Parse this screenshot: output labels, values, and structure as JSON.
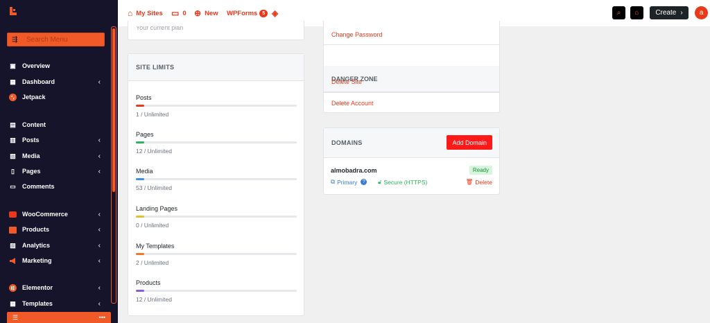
{
  "sidebar": {
    "search_placeholder": "Search Menu",
    "items": [
      {
        "label": "Overview",
        "icon": "grid-icon",
        "chevron": false
      },
      {
        "label": "Dashboard",
        "icon": "dashboard-icon",
        "chevron": true
      },
      {
        "label": "Jetpack",
        "icon": "jetpack-icon",
        "chevron": false
      },
      {
        "label": "Content",
        "icon": "content-icon",
        "chevron": false
      },
      {
        "label": "Posts",
        "icon": "posts-icon",
        "chevron": true
      },
      {
        "label": "Media",
        "icon": "media-icon",
        "chevron": true
      },
      {
        "label": "Pages",
        "icon": "pages-icon",
        "chevron": true
      },
      {
        "label": "Comments",
        "icon": "comments-icon",
        "chevron": false
      },
      {
        "label": "WooCommerce",
        "icon": "woocommerce-icon",
        "chevron": true
      },
      {
        "label": "Products",
        "icon": "products-icon",
        "chevron": true
      },
      {
        "label": "Analytics",
        "icon": "analytics-icon",
        "chevron": true
      },
      {
        "label": "Marketing",
        "icon": "marketing-icon",
        "chevron": true
      },
      {
        "label": "Elementor",
        "icon": "elementor-icon",
        "chevron": true
      },
      {
        "label": "Templates",
        "icon": "templates-icon",
        "chevron": true
      }
    ],
    "bottom_more": "•••"
  },
  "topbar": {
    "my_sites": "My Sites",
    "comments_count": "0",
    "new_label": "New",
    "wpforms_label": "WPForms",
    "wpforms_badge": "5",
    "create_label": "Create",
    "create_chevron": "›",
    "avatar_letter": "a"
  },
  "account_stub": {
    "text": "Your current plan"
  },
  "site_limits": {
    "title": "SITE LIMITS",
    "items": [
      {
        "name": "Posts",
        "value": "1 / Unlimited",
        "color": "#e8391b"
      },
      {
        "name": "Pages",
        "value": "12 / Unlimited",
        "color": "#2bb55a"
      },
      {
        "name": "Media",
        "value": "53 / Unlimited",
        "color": "#3a8ee6"
      },
      {
        "name": "Landing Pages",
        "value": "0 / Unlimited",
        "color": "#e5c02a"
      },
      {
        "name": "My Templates",
        "value": "2 / Unlimited",
        "color": "#f07a28"
      },
      {
        "name": "Products",
        "value": "12 / Unlimited",
        "color": "#8a5cd6"
      }
    ]
  },
  "account": {
    "change_password": "Change Password",
    "danger_zone": "DANGER ZONE",
    "delete_site": "Delete Site",
    "delete_account": "Delete Account"
  },
  "domains": {
    "title": "DOMAINS",
    "add_button": "Add Domain",
    "domain": "almobadra.com",
    "status": "Ready",
    "primary": "Primary",
    "secure": "Secure (HTTPS)",
    "delete": "Delete"
  },
  "colors": {
    "accent": "#e8391b",
    "sidebar_bg": "#16142b",
    "add_button": "#ff1a1a"
  }
}
